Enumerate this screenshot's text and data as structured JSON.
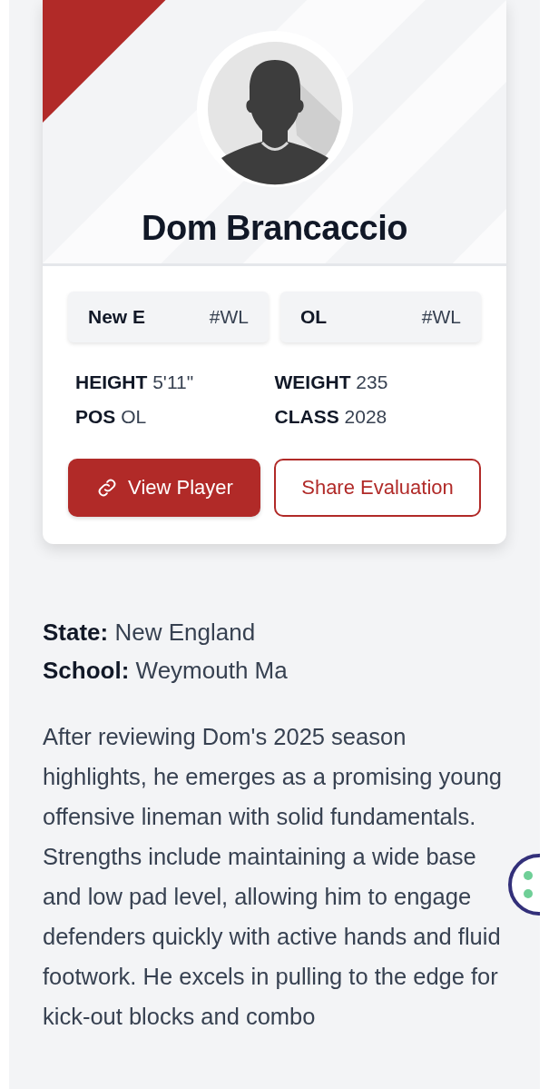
{
  "player": {
    "name": "Dom Brancaccio"
  },
  "tags": [
    {
      "label": "New E",
      "code": "#WL"
    },
    {
      "label": "OL",
      "code": "#WL"
    }
  ],
  "stats": [
    {
      "label": "HEIGHT",
      "value": "5'11\""
    },
    {
      "label": "WEIGHT",
      "value": "235"
    },
    {
      "label": "POS",
      "value": "OL"
    },
    {
      "label": "CLASS",
      "value": "2028"
    }
  ],
  "buttons": [
    {
      "kind": "primary",
      "label": "View Player"
    },
    {
      "kind": "outline",
      "label": "Share Evaluation"
    }
  ],
  "details": [
    {
      "label": "State:",
      "value": "New England"
    },
    {
      "label": "School:",
      "value": "Weymouth Ma"
    }
  ],
  "evaluation": "After reviewing Dom's 2025 season highlights, he emerges as a promising young offensive lineman with solid fundamentals. Strengths include maintaining a wide base and low pad level, allowing him to engage defenders quickly with active hands and fluid footwork. He excels in pulling to the edge for kick-out blocks and combo"
}
